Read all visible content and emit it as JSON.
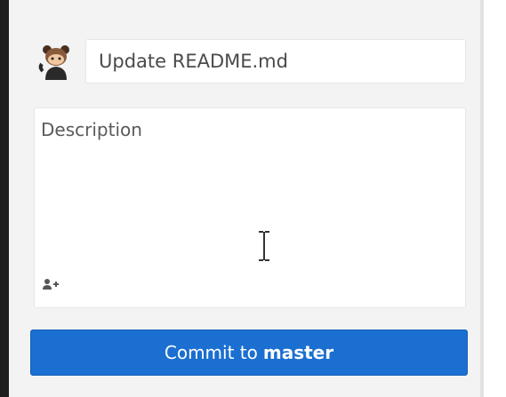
{
  "commit_form": {
    "summary_value": "Update README.md",
    "description_placeholder": "Description",
    "commit_button_prefix": "Commit to",
    "commit_button_branch": "master"
  },
  "icons": {
    "avatar": "octocat-avatar-icon",
    "coauthor": "add-coauthor-icon",
    "cursor": "text-cursor-icon"
  },
  "colors": {
    "accent": "#1a6fd1",
    "panel_background": "#f3f3f3",
    "left_border": "#1e1e1e"
  }
}
